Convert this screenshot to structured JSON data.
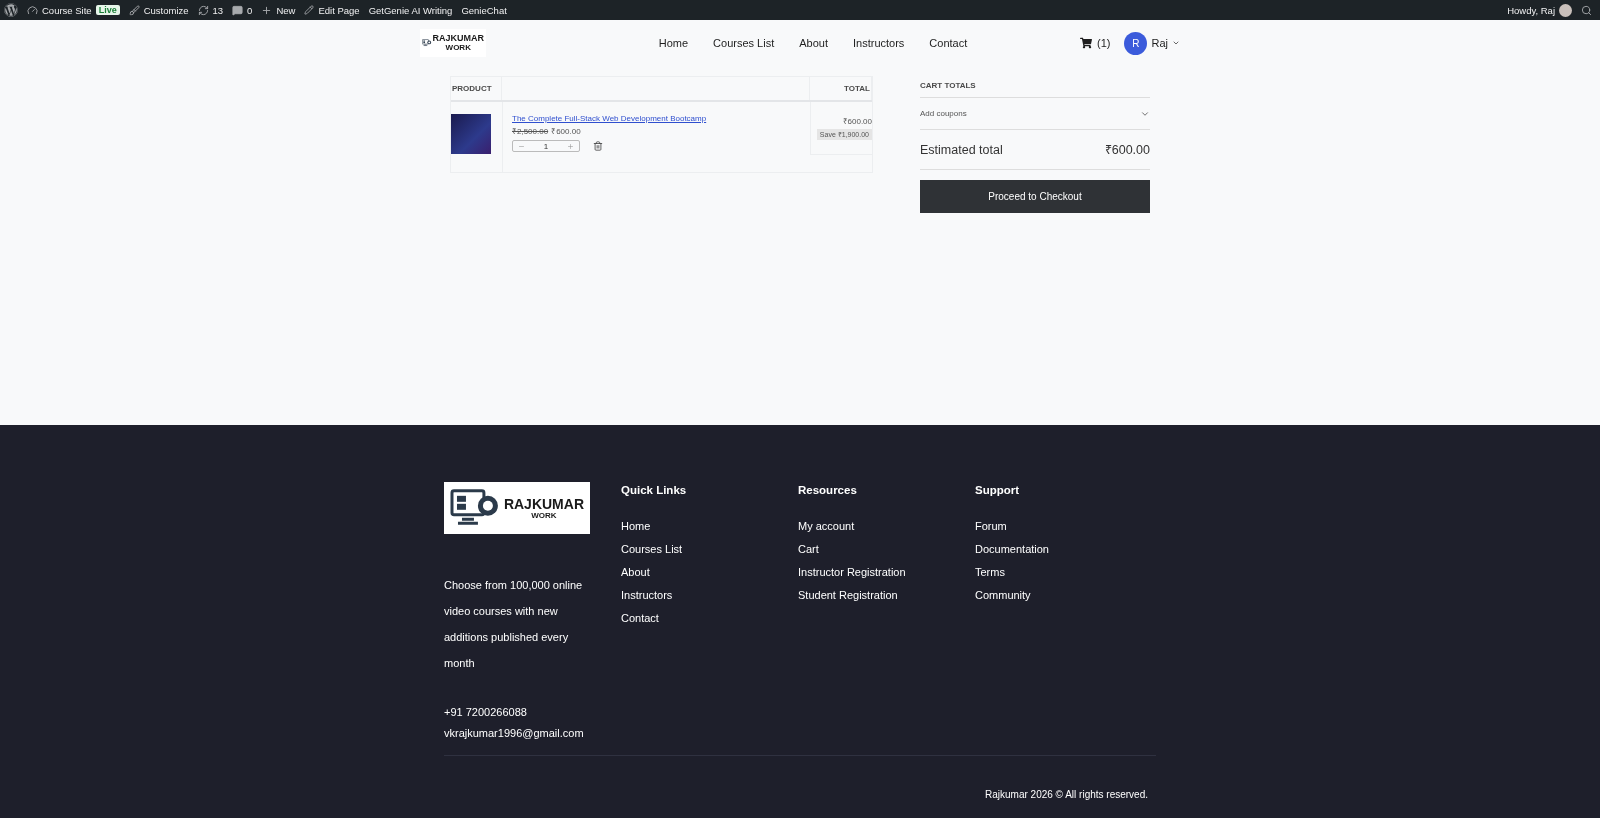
{
  "admin_bar": {
    "items": [
      {
        "kind": "wp"
      },
      {
        "kind": "site",
        "label": "Course Site",
        "badge": "Live"
      },
      {
        "kind": "customize",
        "label": "Customize"
      },
      {
        "kind": "updates",
        "label": "13"
      },
      {
        "kind": "comments",
        "label": "0"
      },
      {
        "kind": "new",
        "label": "New"
      },
      {
        "kind": "edit",
        "label": "Edit Page"
      },
      {
        "kind": "plain",
        "label": "GetGenie AI Writing"
      },
      {
        "kind": "plain",
        "label": "GenieChat"
      }
    ],
    "greeting": "Howdy, Raj"
  },
  "header": {
    "logo": {
      "title": "RAJKUMAR",
      "subtitle": "WORK"
    },
    "nav": [
      "Home",
      "Courses List",
      "About",
      "Instructors",
      "Contact"
    ],
    "cart_count": "(1)",
    "user": {
      "initial": "R",
      "name": "Raj"
    }
  },
  "cart": {
    "columns": [
      "PRODUCT",
      "TOTAL"
    ],
    "items": [
      {
        "title": "The Complete Full-Stack Web Development Bootcamp",
        "old_price": "₹2,500.00",
        "price": "₹600.00",
        "quantity": "1",
        "total": "₹600.00",
        "savings": "Save ₹1,900.00"
      }
    ]
  },
  "totals": {
    "heading": "CART TOTALS",
    "coupons": "Add coupons",
    "estimated_label": "Estimated total",
    "estimated_value": "₹600.00",
    "checkout": "Proceed to Checkout"
  },
  "footer": {
    "logo": {
      "title": "RAJKUMAR",
      "subtitle": "WORK"
    },
    "about": "Choose from 100,000 online video courses with new additions published every month",
    "phone": "+91 7200266088",
    "email": "vkrajkumar1996@gmail.com",
    "columns": [
      {
        "heading": "Quick Links",
        "links": [
          "Home",
          "Courses List",
          "About",
          "Instructors",
          "Contact"
        ]
      },
      {
        "heading": "Resources",
        "links": [
          "My account",
          "Cart",
          "Instructor Registration",
          "Student Registration"
        ]
      },
      {
        "heading": "Support",
        "links": [
          "Forum",
          "Documentation",
          "Terms",
          "Community"
        ]
      }
    ],
    "copyright": "Rajkumar 2026 © All rights reserved."
  }
}
